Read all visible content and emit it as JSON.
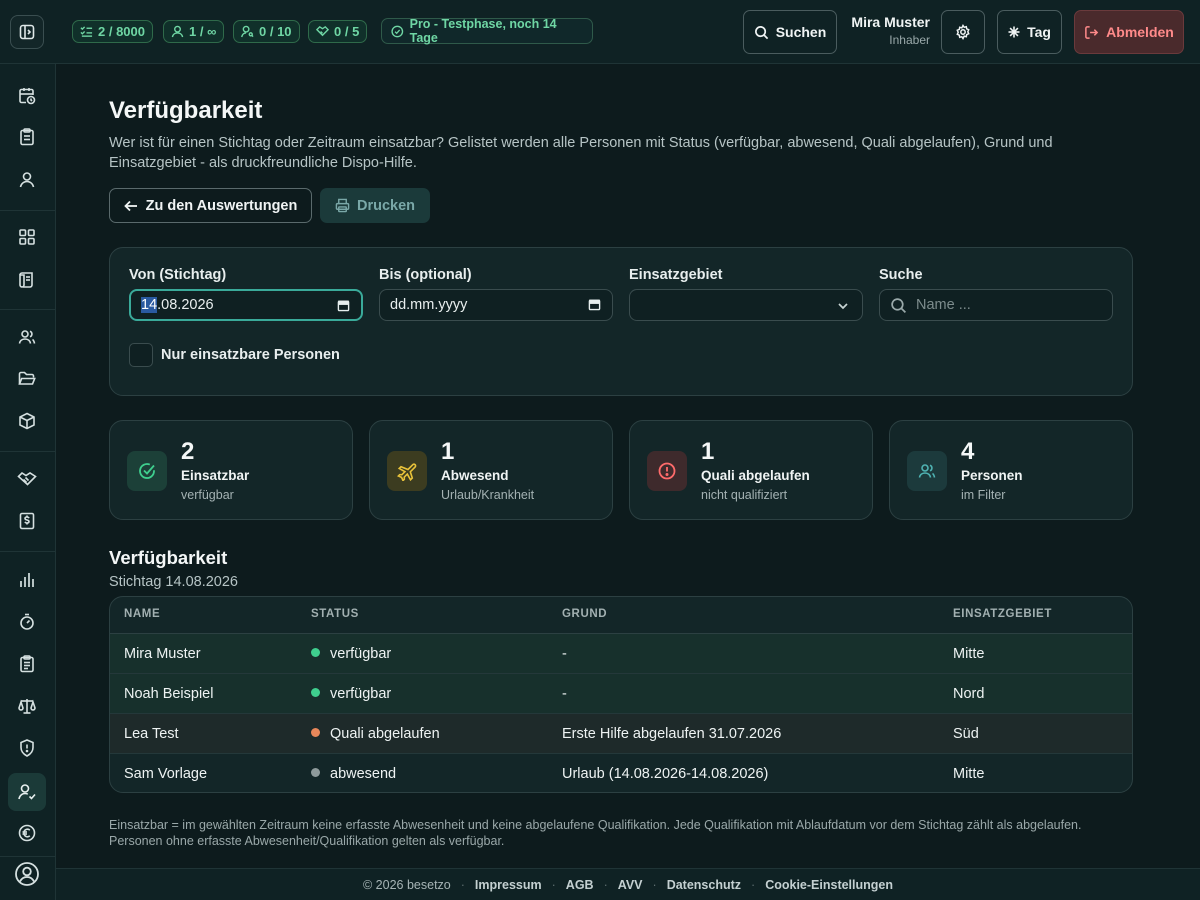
{
  "topbar": {
    "quotas": [
      {
        "icon": "list-check-icon",
        "value": "2 / 8000"
      },
      {
        "icon": "user-icon",
        "value": "1 / ∞"
      },
      {
        "icon": "user-key-icon",
        "value": "0 / 10"
      },
      {
        "icon": "handshake-icon",
        "value": "0 / 5"
      }
    ],
    "plan": "Pro - Testphase, noch 14 Tage",
    "search_label": "Suchen",
    "user_name": "Mira Muster",
    "user_role": "Inhaber",
    "theme_label": "Tag",
    "logout_label": "Abmelden"
  },
  "page": {
    "title": "Verfügbarkeit",
    "description": "Wer ist für einen Stichtag oder Zeitraum einsatzbar? Gelistet werden alle Personen mit Status (verfügbar, abwesend, Quali abgelaufen), Grund und Einsatzgebiet - als druckfreundliche Dispo-Hilfe.",
    "back_label": "Zu den Auswertungen",
    "print_label": "Drucken"
  },
  "filters": {
    "from_label": "Von (Stichtag)",
    "from_value_day": "14",
    "from_value_rest": ".08.2026",
    "to_label": "Bis (optional)",
    "to_value": "dd.mm.yyyy",
    "area_label": "Einsatzgebiet",
    "area_value": "",
    "search_label": "Suche",
    "search_placeholder": "Name ...",
    "only_available_label": "Nur einsatzbare Personen",
    "only_available_checked": false
  },
  "stats": [
    {
      "value": "2",
      "title": "Einsatzbar",
      "sub": "verfügbar",
      "icon": "check-circle-icon",
      "color": "#3fcf8e"
    },
    {
      "value": "1",
      "title": "Abwesend",
      "sub": "Urlaub/Krankheit",
      "icon": "plane-icon",
      "color": "#e8c23a"
    },
    {
      "value": "1",
      "title": "Quali abgelaufen",
      "sub": "nicht qualifiziert",
      "icon": "alert-circle-icon",
      "color": "#ff6b6b"
    },
    {
      "value": "4",
      "title": "Personen",
      "sub": "im Filter",
      "icon": "users-icon",
      "color": "#4fb3b3"
    }
  ],
  "table": {
    "title": "Verfügbarkeit",
    "subtitle": "Stichtag 14.08.2026",
    "headers": [
      "NAME",
      "STATUS",
      "GRUND",
      "EINSATZGEBIET"
    ],
    "rows": [
      {
        "name": "Mira Muster",
        "status": "verfügbar",
        "status_color": "#3fcf8e",
        "reason": "-",
        "area": "Mitte"
      },
      {
        "name": "Noah Beispiel",
        "status": "verfügbar",
        "status_color": "#3fcf8e",
        "reason": "-",
        "area": "Nord"
      },
      {
        "name": "Lea Test",
        "status": "Quali abgelaufen",
        "status_color": "#e8875a",
        "reason": "Erste Hilfe abgelaufen 31.07.2026",
        "area": "Süd"
      },
      {
        "name": "Sam Vorlage",
        "status": "abwesend",
        "status_color": "#8e9a9b",
        "reason": "Urlaub (14.08.2026-14.08.2026)",
        "area": "Mitte"
      }
    ]
  },
  "footnote": "Einsatzbar = im gewählten Zeitraum keine erfasste Abwesenheit und keine abgelaufene Qualifikation. Jede Qualifikation mit Ablaufdatum vor dem Stichtag zählt als abgelaufen. Personen ohne erfasste Abwesenheit/Qualifikation gelten als verfügbar.",
  "footer": {
    "copyright": "© 2026 besetzo",
    "links": [
      "Impressum",
      "AGB",
      "AVV",
      "Datenschutz",
      "Cookie-Einstellungen"
    ]
  },
  "colors": {
    "accent": "#3aaa9a",
    "available": "#3fcf8e",
    "absent": "#8e9a9b",
    "expired": "#e8875a",
    "danger": "#ff8a8a"
  }
}
